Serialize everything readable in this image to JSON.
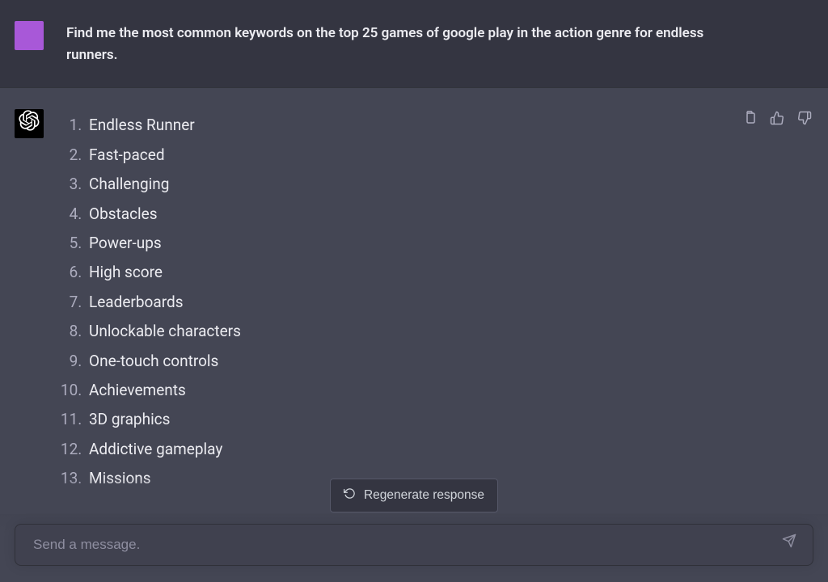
{
  "messages": {
    "user": {
      "text": "Find me the most common keywords on the top 25 games of google play in the action genre for endless runners."
    },
    "assistant": {
      "list": [
        "Endless Runner",
        "Fast-paced",
        "Challenging",
        "Obstacles",
        "Power-ups",
        "High score",
        "Leaderboards",
        "Unlockable characters",
        "One-touch controls",
        "Achievements",
        "3D graphics",
        "Addictive gameplay",
        "Missions"
      ]
    }
  },
  "toolbar": {
    "regenerate_label": "Regenerate response"
  },
  "input": {
    "placeholder": "Send a message."
  }
}
